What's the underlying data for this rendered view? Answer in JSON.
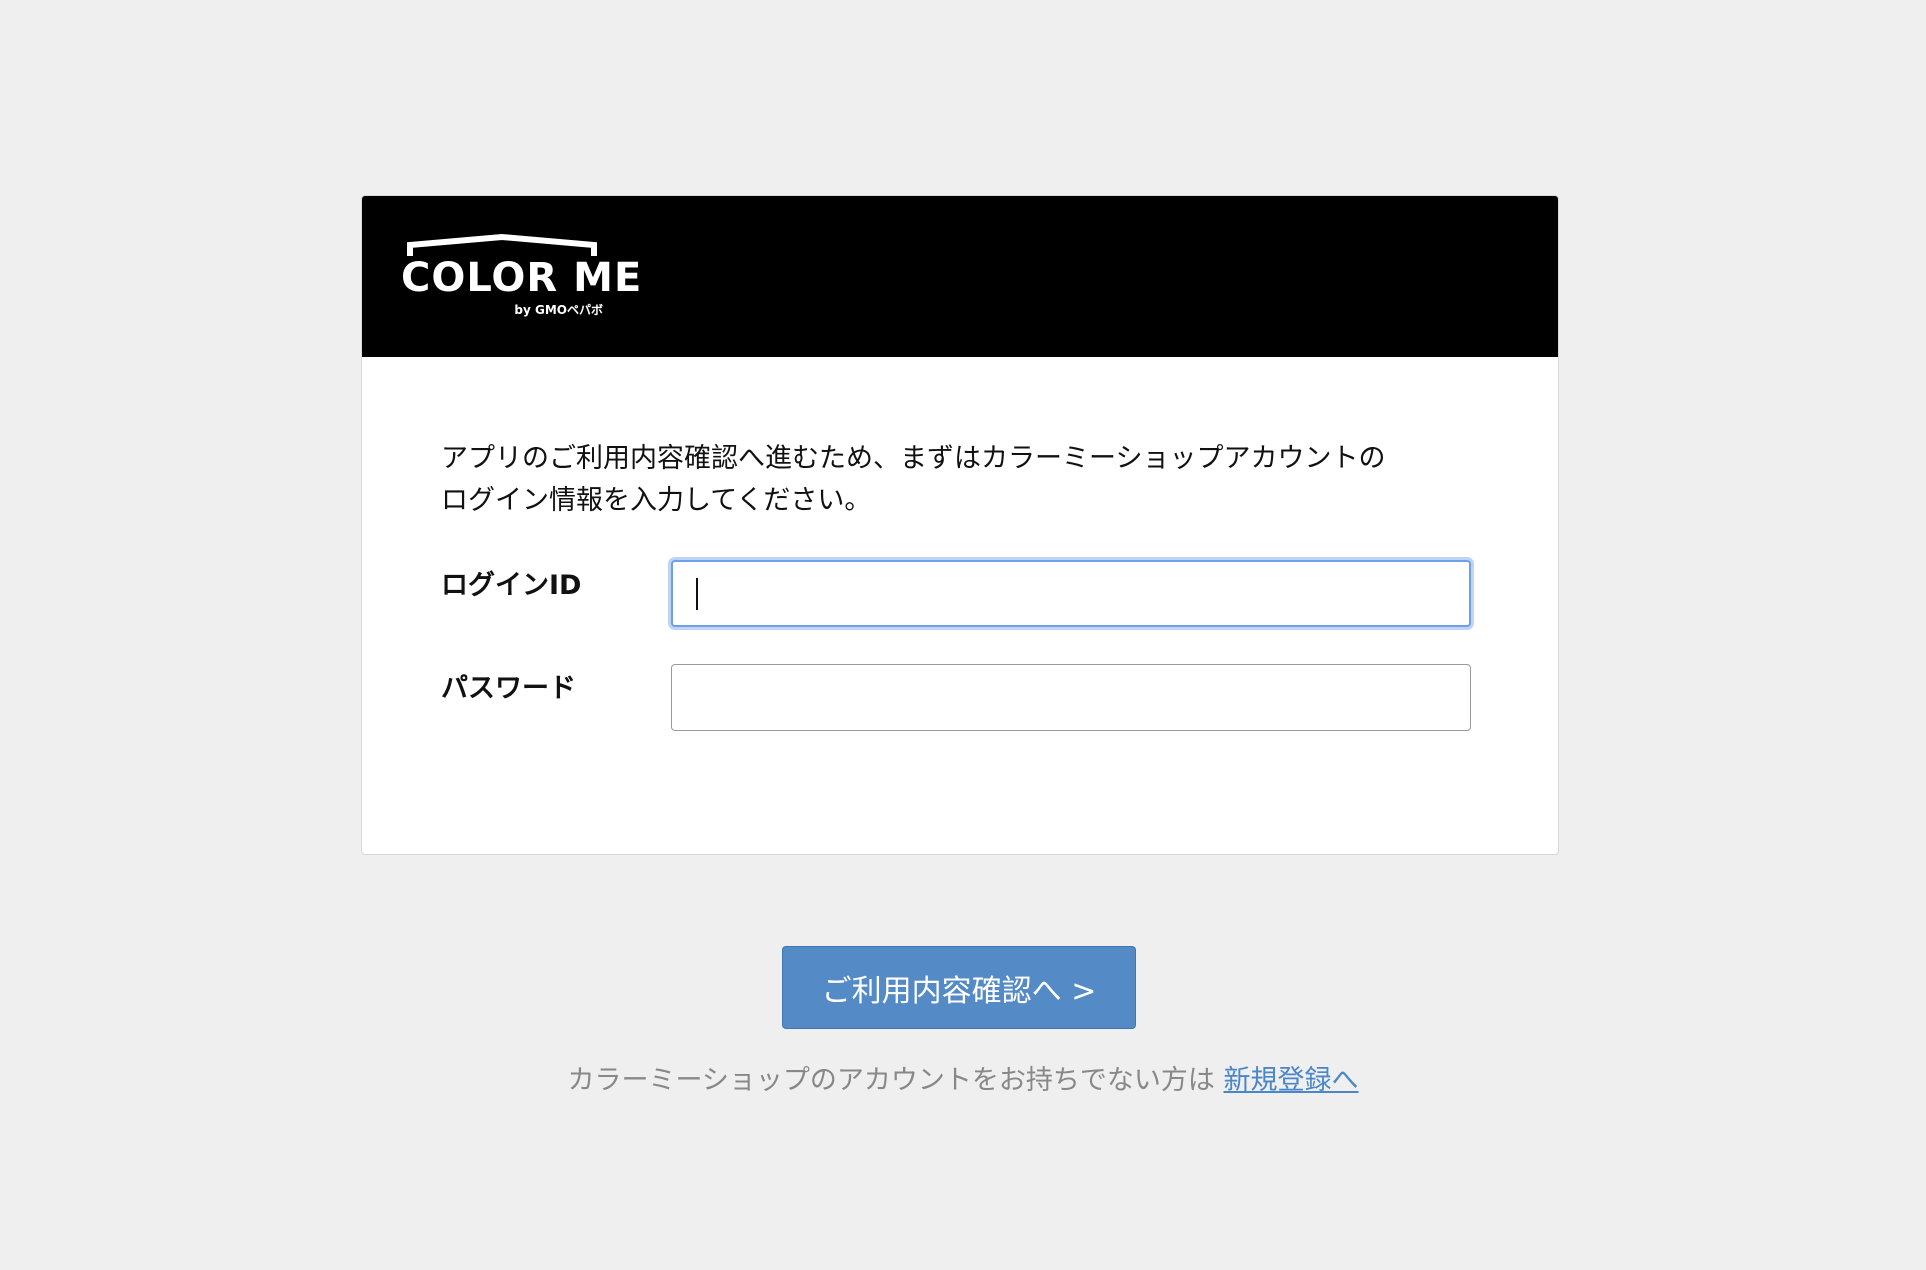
{
  "brand": {
    "logo_text": "COLOR ME",
    "logo_sub": "by GMOペパボ"
  },
  "form": {
    "intro_line1": "アプリのご利用内容確認へ進むため、まずはカラーミーショップアカウントの",
    "intro_line2": "ログイン情報を入力してください。",
    "login_id_label": "ログインID",
    "login_id_value": "",
    "password_label": "パスワード",
    "password_value": ""
  },
  "submit": {
    "label": "ご利用内容確認へ >"
  },
  "signup": {
    "prompt": "カラーミーショップのアカウントをお持ちでない方は ",
    "link_label": "新規登録へ"
  },
  "colors": {
    "background": "#efefef",
    "header": "#000000",
    "button": "#548ac6",
    "link": "#4a86c8",
    "focus_ring": "#6f9fe6"
  },
  "icons": {
    "logo": "color-me-house-logo"
  }
}
